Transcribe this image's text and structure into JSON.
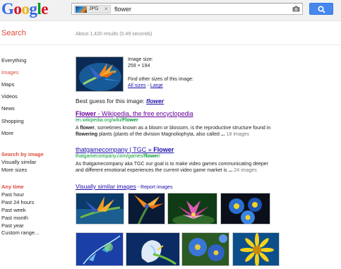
{
  "header": {
    "logo_letters": [
      {
        "ch": "G",
        "color": "#3369e8"
      },
      {
        "ch": "o",
        "color": "#d50f25"
      },
      {
        "ch": "o",
        "color": "#eeb211"
      },
      {
        "ch": "g",
        "color": "#3369e8"
      },
      {
        "ch": "l",
        "color": "#009925"
      },
      {
        "ch": "e",
        "color": "#d50f25"
      }
    ],
    "chip_label": "JPG",
    "chip_close": "×",
    "query": "flower",
    "camera_icon": "camera-icon",
    "search_icon": "search-icon"
  },
  "page": {
    "title": "Search",
    "stats": "About 1,420 results (0.49 seconds)"
  },
  "nav": {
    "items": [
      {
        "label": "Everything",
        "active": false
      },
      {
        "label": "Images",
        "active": true
      },
      {
        "label": "Maps",
        "active": false
      },
      {
        "label": "Videos",
        "active": false
      },
      {
        "label": "News",
        "active": false
      },
      {
        "label": "Shopping",
        "active": false
      },
      {
        "label": "More",
        "active": false
      }
    ],
    "search_by_image": {
      "heading": "Search by image",
      "items": [
        "Visually similar",
        "More sizes"
      ]
    },
    "time": {
      "heading": "Any time",
      "items": [
        "Past hour",
        "Past 24 hours",
        "Past week",
        "Past month",
        "Past year",
        "Custom range..."
      ]
    }
  },
  "query_image": {
    "size_label": "Image size:",
    "size_value": "259 × 194",
    "other_sizes": "Find other sizes of this image:",
    "all_sizes": "All sizes",
    "sep": " - ",
    "large": "Large"
  },
  "best_guess": {
    "prefix": "Best guess for this image: ",
    "query": "flower"
  },
  "results": [
    {
      "title_bold": "Flower",
      "title_rest": " - Wikipedia, the free encyclopedia",
      "title_color": "#660099",
      "url_prefix": "en.wikipedia.org/wiki/",
      "url_bold": "Flower",
      "snippet_line1_pre": "A ",
      "snippet_line1_bold": "flower",
      "snippet_line1_post": ", sometimes known as a bloom or blossom, is the reproductive structure found in",
      "snippet_line2_bold": "flowering",
      "snippet_line2_post": " plants (plants of the division Magnoliophyta, also called ",
      "snippet_ellipsis": "...",
      "meta": " 18 images"
    },
    {
      "title_pre": "thatgamecompany | TGC » ",
      "title_bold": "Flower",
      "title_color": "#1a0dab",
      "url_prefix": "thatgamecompany.com/games/",
      "url_bold": "flower",
      "url_suffix": "/",
      "snippet_line1": "As thatgamecompany aka TGC our goal is to make video games communicating deeper",
      "snippet_line2": "and different emotional experiences the current video game market is ",
      "snippet_ellipsis": "...",
      "meta": " 24 images"
    }
  ],
  "similar": {
    "title": "Visually similar images",
    "report": " - Report images",
    "images": [
      "bird-of-paradise-thumb-1",
      "bird-of-paradise-thumb-2",
      "lotus-thumb",
      "pansy-thumb",
      "fractal-flower-thumb",
      "calla-lily-thumb",
      "blue-poppy-thumb",
      "yellow-daisy-thumb"
    ]
  },
  "colors": {
    "accent_red": "#dd4b39",
    "link_blue": "#1a0dab",
    "url_green": "#009933",
    "search_button": "#4787ed"
  }
}
